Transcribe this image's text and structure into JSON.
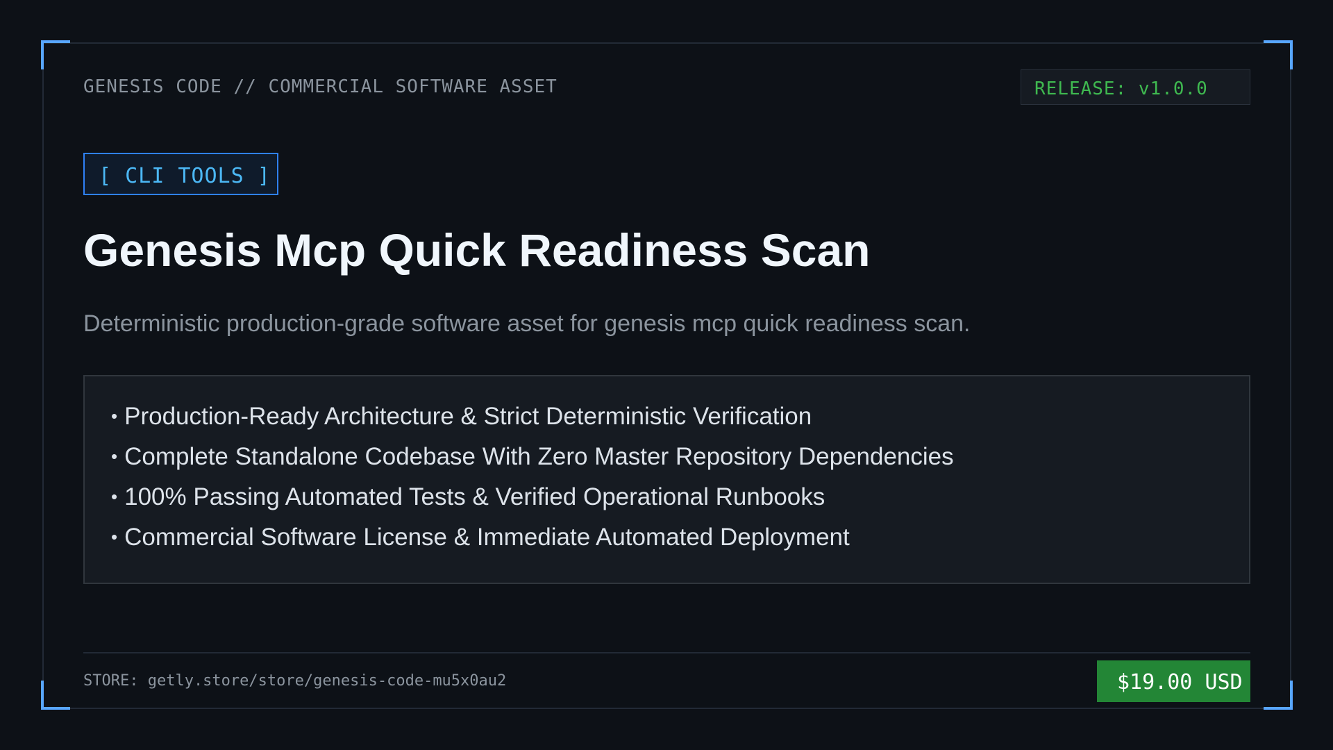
{
  "header": {
    "brand": "GENESIS CODE // COMMERCIAL SOFTWARE ASSET",
    "release": "RELEASE: v1.0.0"
  },
  "product": {
    "category": "[ CLI TOOLS ]",
    "title": "Genesis Mcp Quick Readiness Scan",
    "description": "Deterministic production-grade software asset for genesis mcp quick readiness scan.",
    "features": [
      "Production-Ready Architecture & Strict Deterministic Verification",
      "Complete Standalone Codebase With Zero Master Repository Dependencies",
      "100% Passing Automated Tests & Verified Operational Runbooks",
      "Commercial Software License & Immediate Automated Deployment"
    ]
  },
  "footer": {
    "store": "STORE: getly.store/store/genesis-code-mu5x0au2",
    "price": "$19.00 USD"
  },
  "colors": {
    "background": "#0d1117",
    "accent_blue": "#58a6ff",
    "release_green": "#3fb950",
    "price_green": "#238636",
    "category_text": "#4cb8f5"
  },
  "icons": {
    "bullet": "•"
  }
}
